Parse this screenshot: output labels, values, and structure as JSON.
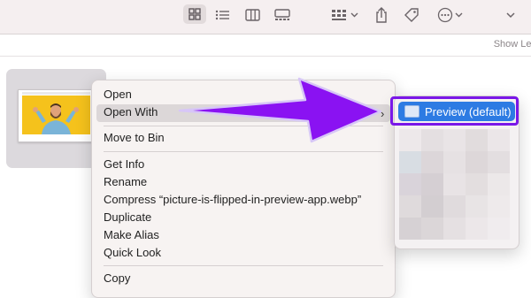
{
  "toolbar": {
    "icons": [
      "grid-view-icon",
      "list-view-icon",
      "column-view-icon",
      "gallery-view-icon",
      "group-icon",
      "share-icon",
      "tag-icon",
      "more-actions-icon",
      "chevron-down-icon"
    ]
  },
  "pathbar": {
    "show_less": "Show Les"
  },
  "context_menu": {
    "open": "Open",
    "open_with": "Open With",
    "move_to_bin": "Move to Bin",
    "get_info": "Get Info",
    "rename": "Rename",
    "compress": "Compress “picture-is-flipped-in-preview-app.webp”",
    "duplicate": "Duplicate",
    "make_alias": "Make Alias",
    "quick_look": "Quick Look",
    "copy": "Copy",
    "submenu_arrow": "›"
  },
  "submenu": {
    "preview_default": "Preview (default)"
  },
  "colors": {
    "accent_purple": "#7a17e8",
    "selection_blue": "#2d7be3"
  }
}
